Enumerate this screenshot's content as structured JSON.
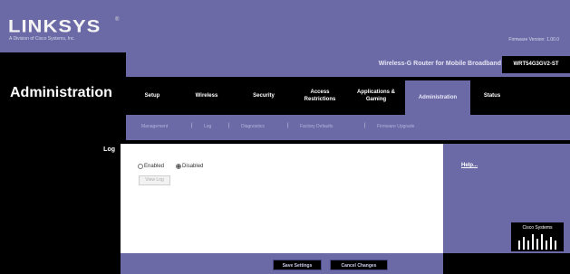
{
  "header": {
    "logo_text": "LINKSYS",
    "logo_tm": "®",
    "tagline": "A Division of Cisco Systems, Inc.",
    "firmware": "Firmware Version: 1.00.0"
  },
  "section_title": "Administration",
  "product": {
    "name": "Wireless-G Router for Mobile Broadband",
    "model": "WRT54G3GV2-ST"
  },
  "tabs": [
    {
      "label": "Setup"
    },
    {
      "label": "Wireless"
    },
    {
      "label": "Security"
    },
    {
      "label": "Access\nRestrictions"
    },
    {
      "label": "Applications &\nGaming"
    },
    {
      "label": "Administration"
    },
    {
      "label": "Status"
    }
  ],
  "subtabs": [
    {
      "label": "Management"
    },
    {
      "label": "Log"
    },
    {
      "label": "Diagnostics"
    },
    {
      "label": "Factory Defaults"
    },
    {
      "label": "Firmware Upgrade"
    }
  ],
  "left_label": "Log",
  "log": {
    "enabled_label": "Enabled",
    "disabled_label": "Disabled",
    "selected": "Disabled",
    "view_log_label": "View Log"
  },
  "help": {
    "label": "Help..."
  },
  "cisco": {
    "label": "Cisco Systems"
  },
  "footer": {
    "save_label": "Save Settings",
    "cancel_label": "Cancel Changes"
  },
  "colors": {
    "accent_purple": "#6c6aa6",
    "black": "#000000",
    "white": "#ffffff"
  }
}
